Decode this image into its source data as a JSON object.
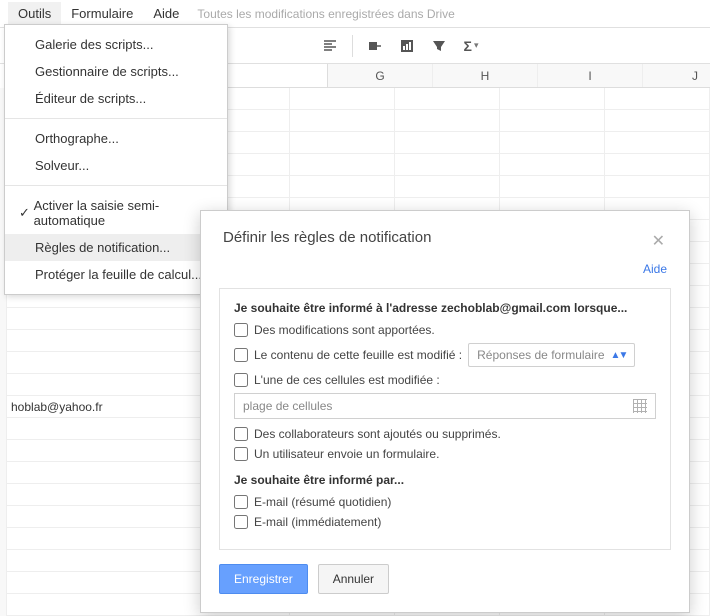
{
  "menubar": {
    "items": [
      "Outils",
      "Formulaire",
      "Aide"
    ],
    "save_status": "Toutes les modifications enregistrées dans Drive"
  },
  "tools_menu": {
    "script_gallery": "Galerie des scripts...",
    "script_manager": "Gestionnaire de scripts...",
    "script_editor": "Éditeur de scripts...",
    "spelling": "Orthographe...",
    "solver": "Solveur...",
    "autocomplete": "Activer la saisie semi-automatique",
    "notification_rules": "Règles de notification...",
    "protect_sheet": "Protéger la feuille de calcul..."
  },
  "columns": [
    "G",
    "H",
    "I",
    "J"
  ],
  "cells": {
    "email_cell": "hoblab@yahoo.fr"
  },
  "dialog": {
    "title": "Définir les règles de notification",
    "help": "Aide",
    "when_title_prefix": "Je souhaite être informé à l'adresse ",
    "email": "zechoblab@gmail.com",
    "when_title_suffix": " lorsque...",
    "opt_changes": "Des modifications sont apportées.",
    "opt_sheet_content": "Le contenu de cette feuille est modifié :",
    "sheet_select": "Réponses de formulaire",
    "opt_cells_modified": "L'une de ces cellules est modifiée :",
    "cell_range_placeholder": "plage de cellules",
    "opt_collaborators": "Des collaborateurs sont ajoutés ou supprimés.",
    "opt_form_submit": "Un utilisateur envoie un formulaire.",
    "how_title": "Je souhaite être informé par...",
    "opt_email_daily": "E-mail (résumé quotidien)",
    "opt_email_immediate": "E-mail (immédiatement)",
    "save": "Enregistrer",
    "cancel": "Annuler"
  }
}
